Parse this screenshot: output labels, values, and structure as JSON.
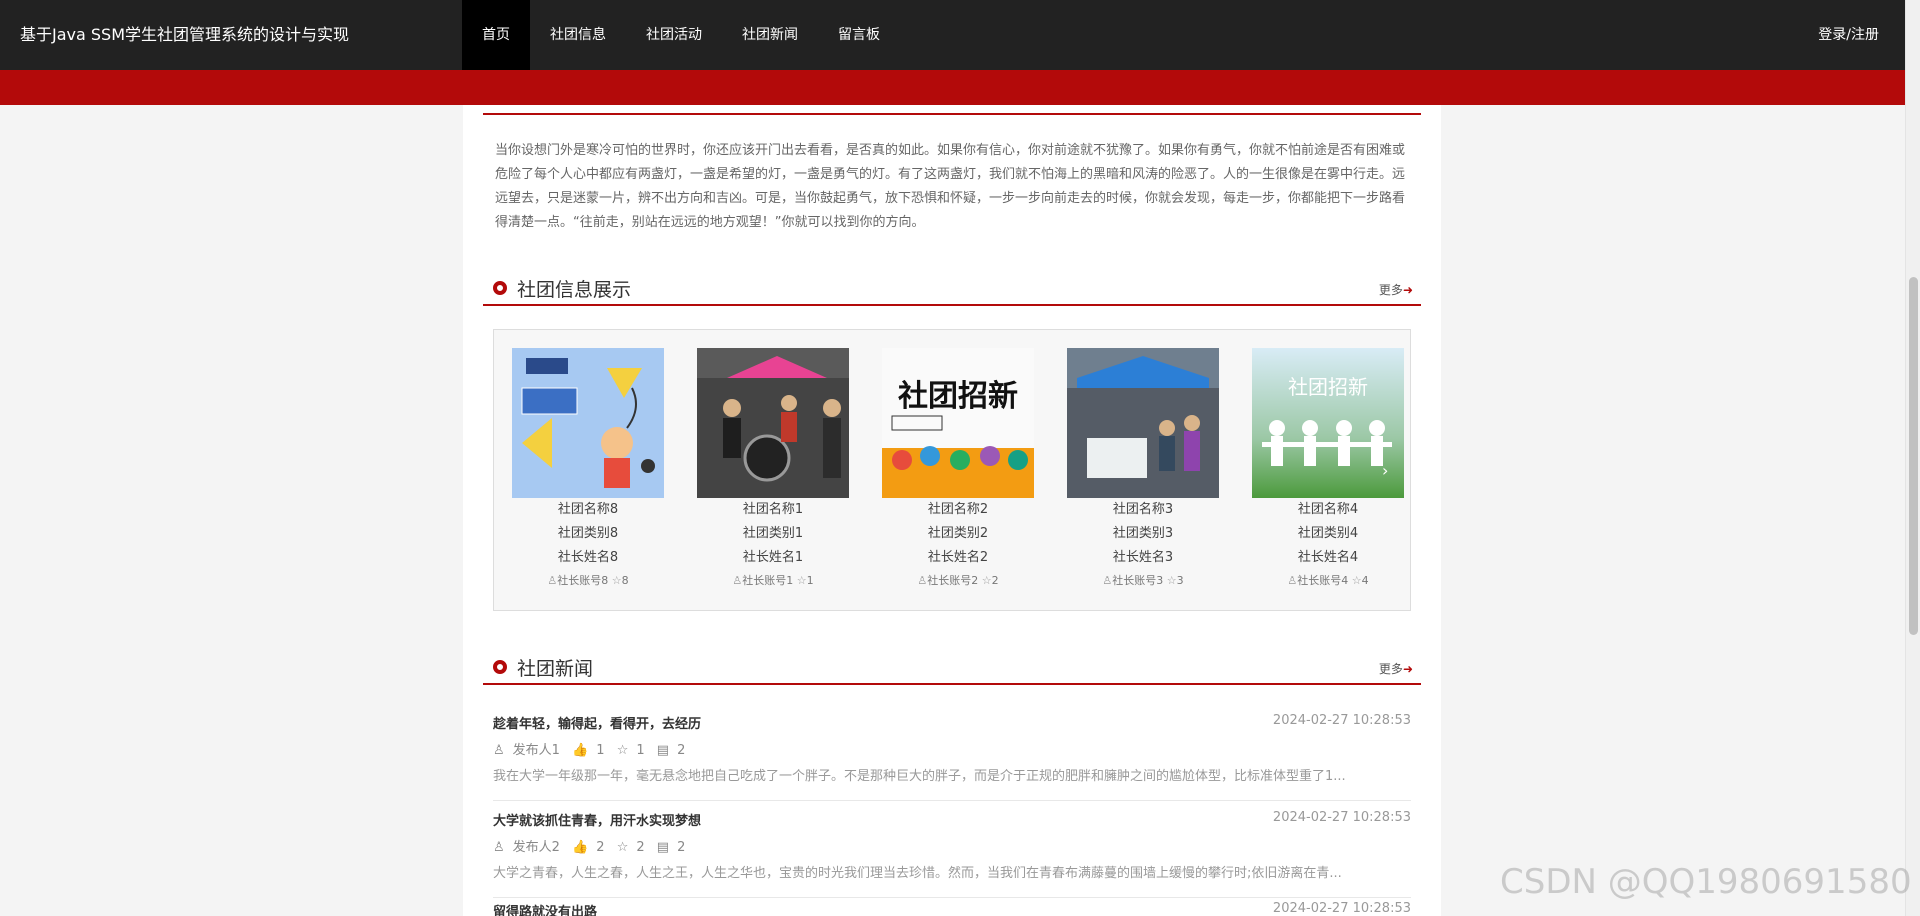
{
  "header": {
    "brand": "基于Java SSM学生社团管理系统的设计与实现",
    "nav": [
      "首页",
      "社团信息",
      "社团活动",
      "社团新闻",
      "留言板"
    ],
    "login": "登录/注册",
    "accent": "#b30a0a"
  },
  "intro": {
    "text": "当你设想门外是寒冷可怕的世界时，你还应该开门出去看看，是否真的如此。如果你有信心，你对前途就不犹豫了。如果你有勇气，你就不怕前途是否有困难或危险了每个人心中都应有两盏灯，一盏是希望的灯，一盏是勇气的灯。有了这两盏灯，我们就不怕海上的黑暗和风涛的险恶了。人的一生很像是在雾中行走。远远望去，只是迷蒙一片，辨不出方向和吉凶。可是，当你鼓起勇气，放下恐惧和怀疑，一步一步向前走去的时候，你就会发现，每走一步，你都能把下一步路看得清楚一点。“往前走，别站在远远的地方观望！”你就可以找到你的方向。"
  },
  "clubs_section": {
    "title": "社团信息展示",
    "more": "更多",
    "cards": [
      {
        "name": "社团名称8",
        "category": "社团类别8",
        "leader": "社长姓名8",
        "account": "社长账号8",
        "stars": "8"
      },
      {
        "name": "社团名称1",
        "category": "社团类别1",
        "leader": "社长姓名1",
        "account": "社长账号1",
        "stars": "1"
      },
      {
        "name": "社团名称2",
        "category": "社团类别2",
        "leader": "社长姓名2",
        "account": "社长账号2",
        "stars": "2",
        "poster": "社团招新"
      },
      {
        "name": "社团名称3",
        "category": "社团类别3",
        "leader": "社长姓名3",
        "account": "社长账号3",
        "stars": "3"
      },
      {
        "name": "社团名称4",
        "category": "社团类别4",
        "leader": "社长姓名4",
        "account": "社长账号4",
        "stars": "4",
        "poster": "社团招新"
      }
    ]
  },
  "news_section": {
    "title": "社团新闻",
    "more": "更多",
    "items": [
      {
        "title": "趁着年轻，输得起，看得开，去经历",
        "date": "2024-02-27 10:28:53",
        "author": "发布人1",
        "likes": "1",
        "favs": "1",
        "comments": "2",
        "desc": "我在大学一年级那一年，毫无悬念地把自己吃成了一个胖子。不是那种巨大的胖子，而是介于正规的肥胖和臃肿之间的尴尬体型，比标准体型重了1..."
      },
      {
        "title": "大学就该抓住青春，用汗水实现梦想",
        "date": "2024-02-27 10:28:53",
        "author": "发布人2",
        "likes": "2",
        "favs": "2",
        "comments": "2",
        "desc": "大学之青春，人生之春，人生之王，人生之华也，宝贵的时光我们理当去珍惜。然而，当我们在青春布满藤蔓的围墙上缓慢的攀行时;依旧游离在青..."
      },
      {
        "title": "留得路就没有出路",
        "date": "2024-02-27 10:28:53"
      }
    ]
  },
  "watermark": "CSDN @QQ1980691580"
}
